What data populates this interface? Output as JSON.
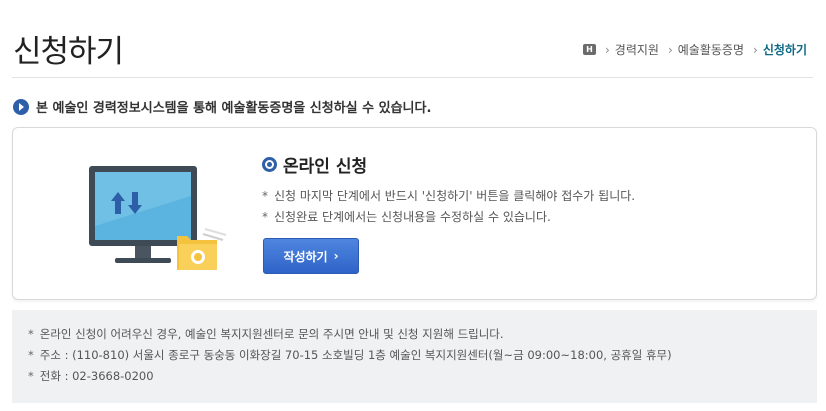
{
  "header": {
    "title": "신청하기",
    "home_icon_text": "H",
    "breadcrumb": [
      "경력지원",
      "예술활동증명",
      "신청하기"
    ]
  },
  "intro": {
    "text": "본 예술인 경력정보시스템을 통해 예술활동증명을 신청하실 수 있습니다."
  },
  "online": {
    "heading": "온라인 신청",
    "notes": [
      "신청 마지막 단계에서 반드시 '신청하기' 버튼을 클릭해야 접수가 됩니다.",
      "신청완료 단계에서는 신청내용을 수정하실 수 있습니다."
    ],
    "button_label": "작성하기",
    "button_chevron": "›"
  },
  "footer": {
    "notes": [
      "온라인 신청이 어려우신 경우, 예술인 복지지원센터로 문의 주시면 안내 및 신청 지원해 드립니다.",
      "주소 : (110-810) 서울시 종로구 동숭동 이화장길 70-15 소호빌딩 1층 예술인 복지지원센터(월~금 09:00~18:00, 공휴일 휴무)",
      "전화 : 02-3668-0200"
    ]
  },
  "colors": {
    "accent_blue": "#2f5fa8",
    "button_blue": "#3a6fd4",
    "current_crumb": "#0d6a86",
    "footer_bg": "#eff1f3"
  }
}
